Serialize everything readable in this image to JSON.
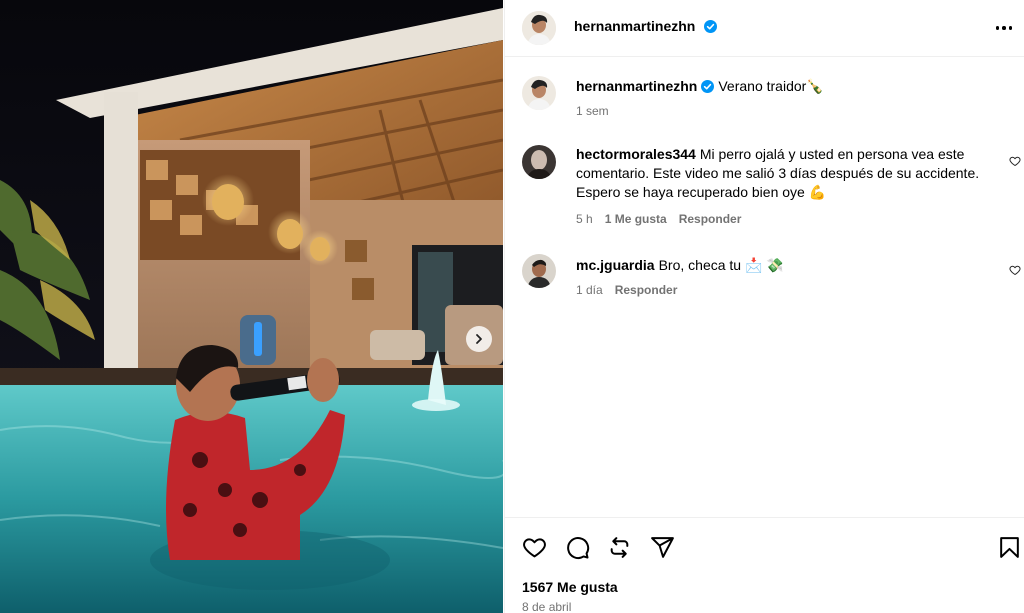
{
  "post": {
    "author": "hernanmartinezhn",
    "caption_username": "hernanmartinezhn",
    "caption": "Verano traidor🍾",
    "caption_time": "1 sem"
  },
  "comments": [
    {
      "username": "hectormorales344",
      "text": "Mi perro ojalá y usted en persona vea este comentario. Este video me salió 3 días después de su accidente. Espero se haya recuperado bien oye 💪",
      "time": "5 h",
      "likes": "1 Me gusta",
      "reply": "Responder"
    },
    {
      "username": "mc.jguardia",
      "text": "Bro, checa tu 📩 💸",
      "time": "1 día",
      "reply": "Responder"
    }
  ],
  "footer": {
    "likes": "1567 Me gusta",
    "date": "8 de abril"
  },
  "icons": {
    "verified_color": "#0095f6",
    "like": "heart-icon",
    "comment": "comment-icon",
    "repost": "repost-icon",
    "share": "share-icon",
    "save": "bookmark-icon",
    "more": "more-options-icon",
    "next": "chevron-right-icon"
  }
}
